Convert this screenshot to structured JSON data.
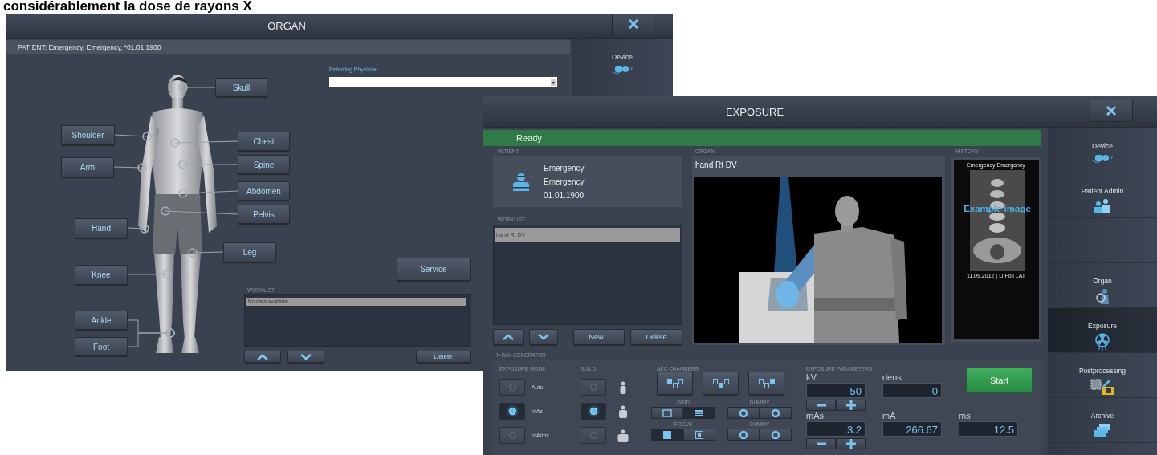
{
  "caption": "considérablement la dose de rayons X",
  "organ_window": {
    "title": "ORGAN",
    "patient": "PATIENT: Emergency, Emergency, *01.01.1900",
    "sidebar": [
      {
        "label": "Device"
      }
    ],
    "body_parts": [
      {
        "label": "Skull"
      },
      {
        "label": "Shoulder"
      },
      {
        "label": "Arm"
      },
      {
        "label": "Chest"
      },
      {
        "label": "Spine"
      },
      {
        "label": "Abdomen"
      },
      {
        "label": "Pelvis"
      },
      {
        "label": "Hand"
      },
      {
        "label": "Leg"
      },
      {
        "label": "Knee"
      },
      {
        "label": "Ankle"
      },
      {
        "label": "Foot"
      }
    ],
    "physician_label": "Referring Physician",
    "service_button": "Service",
    "worklist": {
      "label": "WORKLIST",
      "rows": [
        {
          "text": "No data available",
          "selected": true
        }
      ]
    },
    "delete_button": "Delete"
  },
  "exposure_window": {
    "title": "EXPOSURE",
    "status": "Ready",
    "patient": {
      "label": "PATIENT",
      "lines": [
        "Emergency",
        "Emergency",
        "01.01.1900"
      ]
    },
    "worklist": {
      "label": "WORKLIST",
      "rows": [
        {
          "text": "hand Rt DV",
          "selected": true
        }
      ]
    },
    "list_buttons": [
      "New...",
      "Delete"
    ],
    "organ": {
      "label": "ORGAN",
      "name": "hand Rt DV"
    },
    "history": {
      "label": "HISTORY",
      "caption_top": "Emergency Emergency",
      "overlay": "Example image",
      "caption_bottom": "11.09.2012 | Li Foli LAT"
    },
    "generator": {
      "label": "X-RAY GENERATOR",
      "exposure_mode": {
        "label": "EXPOSURE MODE",
        "options": [
          {
            "label": "Auto",
            "selected": false
          },
          {
            "label": "mAs",
            "selected": true
          },
          {
            "label": "mA/ms",
            "selected": false
          }
        ]
      },
      "build": {
        "label": "BUILD",
        "options": [
          {
            "kind": "slim",
            "selected": false
          },
          {
            "kind": "medium",
            "selected": true
          },
          {
            "kind": "large",
            "selected": false
          }
        ]
      },
      "aec": {
        "label": "AEC CHAMBERS",
        "chambers": [
          {
            "kind": "left"
          },
          {
            "kind": "center"
          },
          {
            "kind": "right"
          }
        ]
      },
      "grid": {
        "label": "GRID",
        "options": [
          {
            "kind": "open",
            "selected": false
          },
          {
            "kind": "lines",
            "selected": true
          }
        ]
      },
      "focus": {
        "label": "FOCUS",
        "options": [
          {
            "kind": "large",
            "selected": true
          },
          {
            "kind": "small",
            "selected": false
          }
        ]
      },
      "dummies": [
        {
          "label": "DUMMY"
        },
        {
          "label": "DUMMY"
        }
      ],
      "parameters": {
        "label": "EXPOSURE PARAMETERS",
        "rows": [
          [
            {
              "kind": "stepper",
              "label": "kV",
              "value": "50"
            },
            {
              "kind": "plain",
              "label": "dens",
              "value": "0"
            }
          ],
          [
            {
              "kind": "stepper",
              "label": "mAs",
              "value": "3.2"
            },
            {
              "kind": "plain",
              "label": "mA",
              "value": "266.67"
            },
            {
              "kind": "plain",
              "label": "ms",
              "value": "12.5"
            }
          ]
        ]
      },
      "start_button": "Start"
    },
    "sidebar": [
      {
        "kind": "entry",
        "label": "Device",
        "selected": false
      },
      {
        "kind": "entry",
        "label": "Patient Admin",
        "selected": false
      },
      {
        "kind": "spacer"
      },
      {
        "kind": "entry",
        "label": "Organ",
        "selected": false
      },
      {
        "kind": "entry",
        "label": "Exposure",
        "selected": true
      },
      {
        "kind": "entry",
        "label": "Postprocessing",
        "selected": false
      },
      {
        "kind": "entry",
        "label": "Archive",
        "selected": false
      }
    ]
  }
}
